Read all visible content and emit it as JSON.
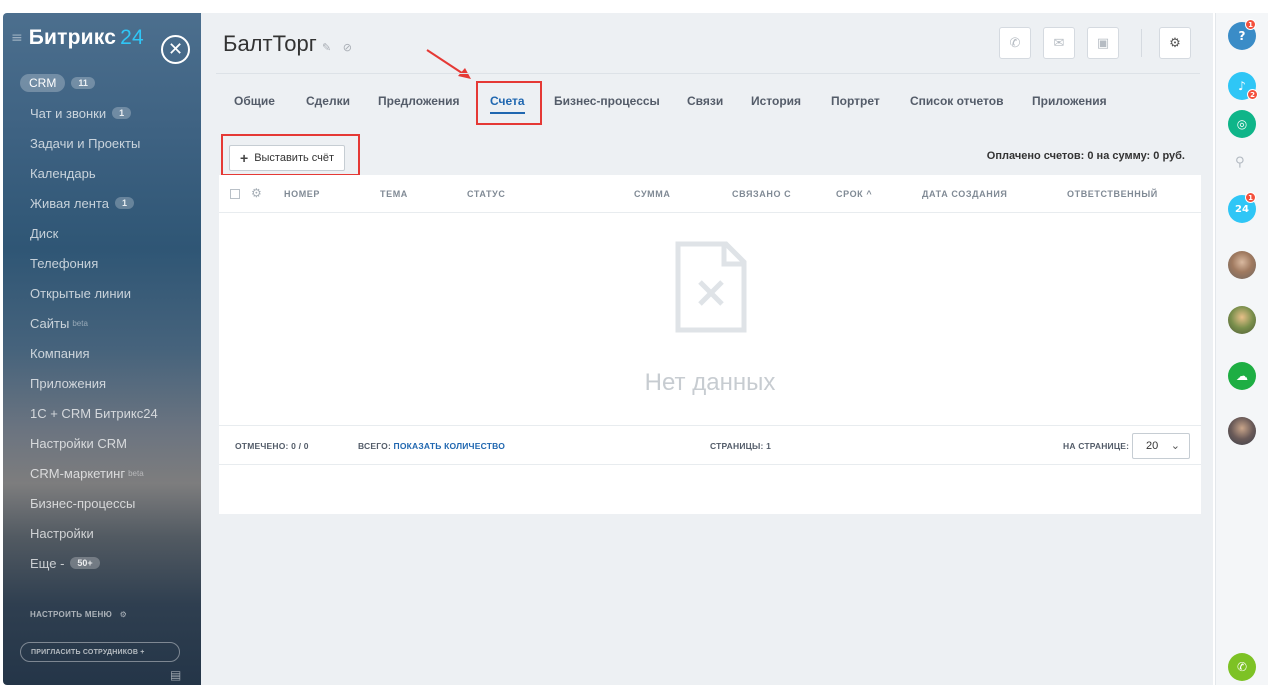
{
  "sidebar": {
    "logo": "Битрикс",
    "logo_number": "24",
    "items": [
      {
        "label": "CRM",
        "counter": "11"
      },
      {
        "label": "Чат и звонки",
        "counter": "1"
      },
      {
        "label": "Задачи и Проекты",
        "counter": ""
      },
      {
        "label": "Календарь",
        "counter": ""
      },
      {
        "label": "Живая лента",
        "counter": "1"
      },
      {
        "label": "Диск",
        "counter": ""
      },
      {
        "label": "Телефония",
        "counter": ""
      },
      {
        "label": "Открытые линии",
        "counter": ""
      },
      {
        "label": "Сайты",
        "counter": "",
        "beta": "beta"
      },
      {
        "label": "Компания",
        "counter": ""
      },
      {
        "label": "Приложения",
        "counter": ""
      },
      {
        "label": "1С + CRM Битрикс24",
        "counter": ""
      },
      {
        "label": "Настройки CRM",
        "counter": ""
      },
      {
        "label": "CRM-маркетинг",
        "counter": "",
        "beta": "beta"
      },
      {
        "label": "Бизнес-процессы",
        "counter": ""
      },
      {
        "label": "Настройки",
        "counter": ""
      },
      {
        "label": "Еще -",
        "counter": "50+"
      }
    ],
    "setup_menu": "НАСТРОИТЬ МЕНЮ",
    "invite": "ПРИГЛАСИТЬ СОТРУДНИКОВ +"
  },
  "header": {
    "title": "БалтТорг"
  },
  "tabs": [
    {
      "label": "Общие",
      "active": false
    },
    {
      "label": "Сделки",
      "active": false
    },
    {
      "label": "Предложения",
      "active": false
    },
    {
      "label": "Счета",
      "active": true
    },
    {
      "label": "Бизнес-процессы",
      "active": false
    },
    {
      "label": "Связи",
      "active": false
    },
    {
      "label": "История",
      "active": false
    },
    {
      "label": "Портрет",
      "active": false
    },
    {
      "label": "Список отчетов",
      "active": false
    },
    {
      "label": "Приложения",
      "active": false
    }
  ],
  "toolbar": {
    "add_invoice": "Выставить счёт",
    "summary": "Оплачено счетов: 0 на сумму: 0 руб."
  },
  "grid": {
    "columns": [
      "НОМЕР",
      "ТЕМА",
      "СТАТУС",
      "СУММА",
      "СВЯЗАНО С",
      "СРОК ^",
      "ДАТА СОЗДАНИЯ",
      "ОТВЕТСТВЕННЫЙ"
    ],
    "empty_text": "Нет данных",
    "footer": {
      "checked_label": "ОТМЕЧЕНО:",
      "checked_value": "0 / 0",
      "total_label": "ВСЕГО:",
      "total_link": "ПОКАЗАТЬ КОЛИЧЕСТВО",
      "pages_label": "СТРАНИЦЫ:",
      "pages_value": "1",
      "per_page_label": "НА СТРАНИЦЕ:",
      "per_page_value": "20"
    }
  },
  "rail": {
    "help_badge": "1",
    "notifications_badge": "2",
    "calendar_badge": "1",
    "calendar_label": "24"
  },
  "colors": {
    "accent": "#2067b0",
    "highlight": "#e53935",
    "rail_green": "#1eae43",
    "rail_blue": "#2fc6f6"
  }
}
